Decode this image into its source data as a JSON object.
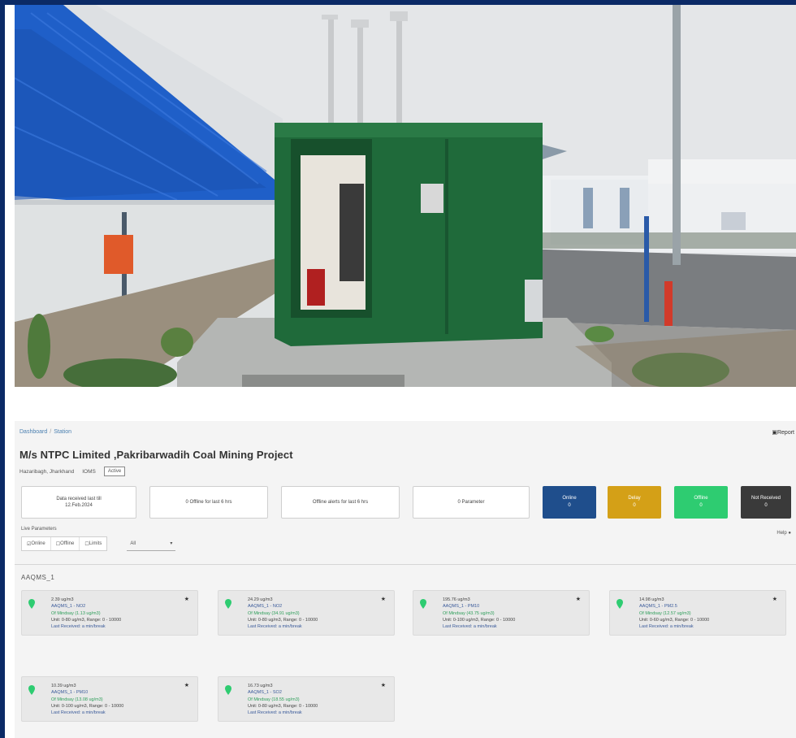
{
  "breadcrumb": [
    "Dashboard",
    "Station"
  ],
  "report_link": "Report",
  "title": "M/s NTPC Limited ,Pakribarwadih Coal Mining Project",
  "meta": {
    "location": "Hazaribagh, Jharkhand",
    "id": "IOMS",
    "status": "Active"
  },
  "summary_cards": [
    {
      "line1": "Data received last till",
      "line2": "12.Feb.2024"
    },
    {
      "line1": "0 Offline for last 6 hrs"
    },
    {
      "line1": "Offline alerts for last 6 hrs"
    },
    {
      "line1": "0 Parameter"
    }
  ],
  "status_cards": [
    {
      "label": "Online",
      "count": "0",
      "color": "#1f4e8c"
    },
    {
      "label": "Delay",
      "count": "0",
      "color": "#d4a017"
    },
    {
      "label": "Offline",
      "count": "0",
      "color": "#2ecc71"
    },
    {
      "label": "Not Received",
      "count": "0",
      "color": "#3a3a3a"
    }
  ],
  "filter_label": "Live Parameters",
  "filters": [
    "Online",
    "Offline",
    "Limits"
  ],
  "select_value": "All",
  "help": "Help",
  "section_title": "AAQMS_1",
  "params": [
    {
      "value": "2.39 ug/m3",
      "name": "AAQMS_1 - NO2",
      "limit": "Of Mindsay (1.13 ug/m3)",
      "unit_range": "Unit: 0-80 ug/m3, Range: 0 - 10000",
      "last": "Last Received: a min/break"
    },
    {
      "value": "24.29 ug/m3",
      "name": "AAQMS_1 - NO2",
      "limit": "Of Mindsay (34.91 ug/m3)",
      "unit_range": "Unit: 0-80 ug/m3, Range: 0 - 10000",
      "last": "Last Received: a min/break"
    },
    {
      "value": "195.76 ug/m3",
      "name": "AAQMS_1 - PM10",
      "limit": "Of Mindsay (43.75 ug/m3)",
      "unit_range": "Unit: 0-100 ug/m3, Range: 0 - 10000",
      "last": "Last Received: a min/break"
    },
    {
      "value": "14.98 ug/m3",
      "name": "AAQMS_1 - PM2.5",
      "limit": "Of Mindsay (12.57 ug/m3)",
      "unit_range": "Unit: 0-60 ug/m3, Range: 0 - 10000",
      "last": "Last Received: a min/break"
    },
    {
      "value": "10.39 ug/m3",
      "name": "AAQMS_1 - PM10",
      "limit": "Of Mindsay (13.08 ug/m3)",
      "unit_range": "Unit: 0-100 ug/m3, Range: 0 - 10000",
      "last": "Last Received: a min/break"
    },
    {
      "value": "16.73 ug/m3",
      "name": "AAQMS_1 - SO2",
      "limit": "Of Mindsay (18.55 ug/m3)",
      "unit_range": "Unit: 0-80 ug/m3, Range: 0 - 10000",
      "last": "Last Received: a min/break"
    }
  ],
  "colors": {
    "frame": "#0b2a66",
    "marker": "#2ecc71",
    "link": "#4a7fb0"
  }
}
